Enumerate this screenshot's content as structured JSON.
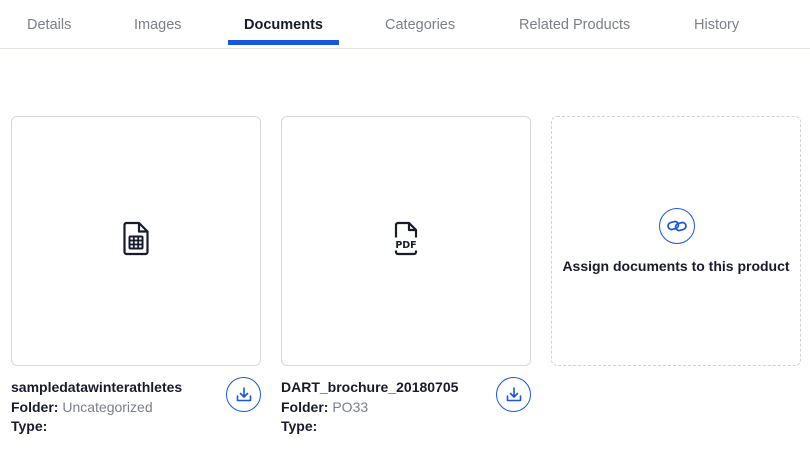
{
  "tabs": [
    {
      "label": "Details"
    },
    {
      "label": "Images"
    },
    {
      "label": "Documents"
    },
    {
      "label": "Categories"
    },
    {
      "label": "Related Products"
    },
    {
      "label": "History"
    }
  ],
  "active_tab": "Documents",
  "documents": [
    {
      "name": "sampledatawinterathletes",
      "folder_label": "Folder:",
      "folder": "Uncategorized",
      "type_label": "Type:",
      "type": "",
      "icon": "spreadsheet-file-icon"
    },
    {
      "name": "DART_brochure_20180705",
      "folder_label": "Folder:",
      "folder": "PO33",
      "type_label": "Type:",
      "type": "",
      "icon": "pdf-file-icon",
      "icon_text": "PDF"
    }
  ],
  "assign": {
    "label": "Assign documents to this product",
    "icon": "link-icon"
  },
  "colors": {
    "accent": "#1a56db",
    "text": "#171b2e",
    "muted": "#7b7f8a",
    "border": "#d6d8de"
  }
}
